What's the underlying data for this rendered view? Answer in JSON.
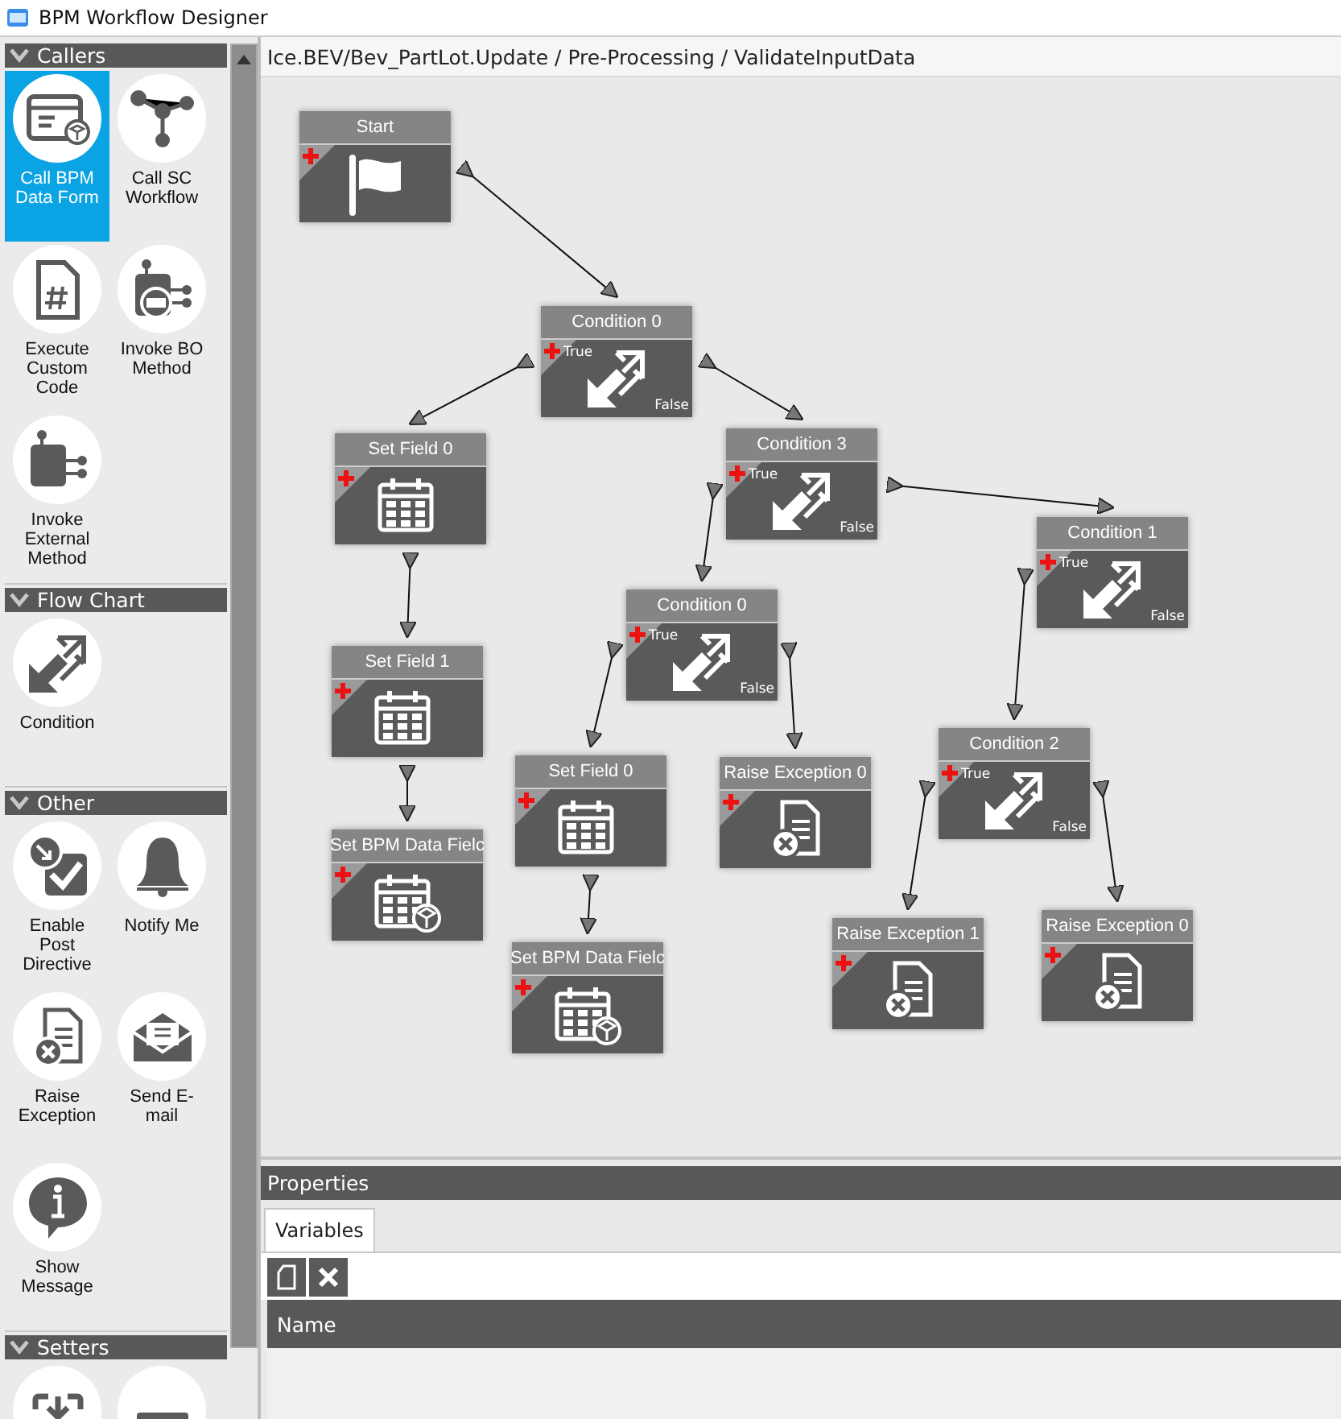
{
  "window": {
    "title": "BPM Workflow Designer"
  },
  "palette": [
    {
      "title": "Callers",
      "items": [
        {
          "kind": "form",
          "label": "Call BPM Data Form",
          "selected": true
        },
        {
          "kind": "workflow",
          "label": "Call SC Workflow",
          "selected": false
        },
        {
          "kind": "code",
          "label": "Execute Custom Code",
          "selected": false
        },
        {
          "kind": "bo",
          "label": "Invoke BO Method",
          "selected": false
        },
        {
          "kind": "external",
          "label": "Invoke External Method",
          "selected": false
        }
      ]
    },
    {
      "title": "Flow Chart",
      "items": [
        {
          "kind": "condition",
          "label": "Condition",
          "selected": false
        }
      ]
    },
    {
      "title": "Other",
      "items": [
        {
          "kind": "directive",
          "label": "Enable Post Directive",
          "selected": false
        },
        {
          "kind": "bell",
          "label": "Notify Me",
          "selected": false
        },
        {
          "kind": "exception",
          "label": "Raise Exception",
          "selected": false
        },
        {
          "kind": "email",
          "label": "Send E-mail",
          "selected": false
        },
        {
          "kind": "info",
          "label": "Show Message",
          "selected": false
        }
      ]
    },
    {
      "title": "Setters",
      "items": [
        {
          "kind": "setter-in",
          "selected": false
        },
        {
          "kind": "setter-field",
          "selected": false
        }
      ]
    }
  ],
  "breadcrumb": "Ice.BEV/Bev_PartLot.Update / Pre-Processing / ValidateInputData",
  "nodes": [
    {
      "kind": "start",
      "title": "Start"
    },
    {
      "kind": "condition",
      "title": "Condition 0",
      "true_label": "True",
      "false_label": "False"
    },
    {
      "kind": "setfield",
      "title": "Set Field 0"
    },
    {
      "kind": "condition",
      "title": "Condition 3",
      "true_label": "True",
      "false_label": "False"
    },
    {
      "kind": "condition",
      "title": "Condition 1",
      "true_label": "True",
      "false_label": "False"
    },
    {
      "kind": "condition",
      "title": "Condition 0",
      "true_label": "True",
      "false_label": "False"
    },
    {
      "kind": "setfield",
      "title": "Set Field 1"
    },
    {
      "kind": "setfield",
      "title": "Set Field 0"
    },
    {
      "kind": "exception",
      "title": "Raise Exception 0"
    },
    {
      "kind": "condition",
      "title": "Condition 2",
      "true_label": "True",
      "false_label": "False"
    },
    {
      "kind": "setbpm",
      "title": "Set BPM Data Fielc"
    },
    {
      "kind": "setbpm",
      "title": "Set BPM Data Fielc"
    },
    {
      "kind": "exception",
      "title": "Raise Exception 1"
    },
    {
      "kind": "exception",
      "title": "Raise Exception 0"
    }
  ],
  "properties": {
    "title": "Properties",
    "tabs": [
      {
        "label": "Variables",
        "selected": true
      }
    ],
    "columns": [
      "Name"
    ]
  }
}
